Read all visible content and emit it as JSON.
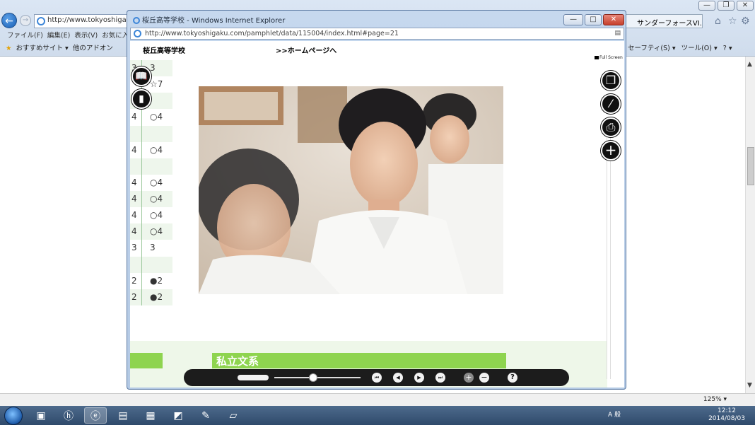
{
  "background_browser": {
    "address": "http://www.tokyoshigaku.c",
    "right_tab_title": "サンダーフォースVI...",
    "window_controls": [
      "—",
      "❐",
      "✕"
    ],
    "menu": [
      "ファイル(F)",
      "編集(E)",
      "表示(V)",
      "お気に入"
    ],
    "favorites": [
      "おすすめサイト ▾",
      "他のアドオン"
    ],
    "commands": [
      "セーフティ(S) ▾",
      "ツール(O) ▾",
      "? ▾"
    ],
    "zoom_label": "125% ▾",
    "scroll_up": "▲",
    "scroll_down": "▼"
  },
  "popup": {
    "title": "桜丘高等学校 - Windows Internet Explorer",
    "address": "http://www.tokyoshigaku.com/pamphlet/data/115004/index.html#page=21",
    "minimize": "—",
    "maximize": "□",
    "close": "✕"
  },
  "page": {
    "school_name": "桜丘高等学校",
    "home_link": ">>ホームページへ",
    "fullscreen_label": "Full Screen",
    "band_label": "私立文系",
    "left_table_rows": [
      {
        "c1": "3",
        "c2": "3",
        "green": true
      },
      {
        "c1": "",
        "c2": "☆7",
        "green": false
      },
      {
        "c1": "",
        "c2": "",
        "green": true
      },
      {
        "c1": "4",
        "c2": "○4",
        "green": false
      },
      {
        "c1": "",
        "c2": "",
        "green": true
      },
      {
        "c1": "4",
        "c2": "○4",
        "green": false
      },
      {
        "c1": "",
        "c2": "",
        "green": true
      },
      {
        "c1": "4",
        "c2": "○4",
        "green": false
      },
      {
        "c1": "4",
        "c2": "○4",
        "green": true
      },
      {
        "c1": "4",
        "c2": "○4",
        "green": false
      },
      {
        "c1": "4",
        "c2": "○4",
        "green": true
      },
      {
        "c1": "3",
        "c2": "3",
        "green": false
      },
      {
        "c1": "",
        "c2": "",
        "green": true
      },
      {
        "c1": "2",
        "c2": "●2",
        "green": false
      },
      {
        "c1": "2",
        "c2": "●2",
        "green": true
      }
    ]
  },
  "toolbar": {
    "slider_value": 0.45,
    "icons": [
      "first-page-icon",
      "prev-page-icon",
      "next-page-icon",
      "last-page-icon",
      "zoom-in-icon",
      "zoom-out-icon",
      "help-icon"
    ],
    "help": "?"
  },
  "taskbar": {
    "tray_text": "A 般",
    "time": "12:12",
    "date": "2014/08/03"
  },
  "colors": {
    "green_band": "#8ed44f",
    "taskbar": "#2f4a6b",
    "control_bar": "#1c1c1c"
  }
}
